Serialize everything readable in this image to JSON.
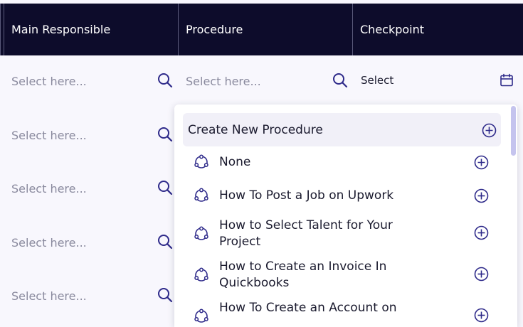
{
  "columns": {
    "main_responsible": "Main Responsible",
    "procedure": "Procedure",
    "checkpoint": "Checkpoint"
  },
  "rows": [
    {
      "main_responsible_placeholder": "Select here...",
      "procedure_placeholder": "Select here...",
      "checkpoint_value": "Select"
    },
    {
      "main_responsible_placeholder": "Select here..."
    },
    {
      "main_responsible_placeholder": "Select here..."
    },
    {
      "main_responsible_placeholder": "Select here..."
    },
    {
      "main_responsible_placeholder": "Select here..."
    }
  ],
  "dropdown": {
    "create_label": "Create New Procedure",
    "items": [
      {
        "label": "None"
      },
      {
        "label": "How To Post a Job on Upwork"
      },
      {
        "label": "How to Select Talent for Your Project"
      },
      {
        "label": "How to Create an Invoice In Quickbooks"
      },
      {
        "label": "How To Create an Account on"
      }
    ]
  },
  "icons": {
    "search": "search-icon",
    "calendar": "calendar-icon",
    "add": "plus-circle-icon",
    "procedure": "procedure-icon"
  },
  "colors": {
    "header_bg": "#0d0c2b",
    "accent": "#2e2a8a",
    "page_bg": "#f8f7fd",
    "scrollbar": "#c5c4ee"
  }
}
